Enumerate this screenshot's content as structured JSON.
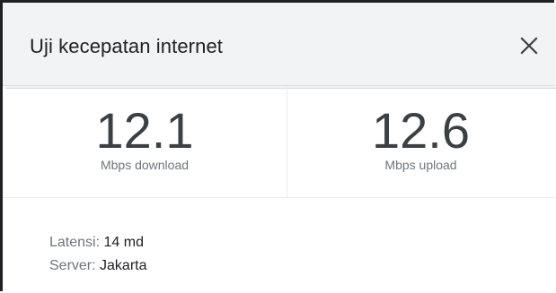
{
  "dialog": {
    "title": "Uji kecepatan internet",
    "close_icon": "close-icon"
  },
  "results": {
    "download": {
      "value": "12.1",
      "unit": "Mbps download"
    },
    "upload": {
      "value": "12.6",
      "unit": "Mbps upload"
    }
  },
  "details": {
    "latency_label": "Latensi:",
    "latency_value": "14 md",
    "server_label": "Server:",
    "server_value": "Jakarta"
  },
  "colors": {
    "header_bg": "#f1f3f4",
    "text_primary": "#202124",
    "text_secondary": "#70757a",
    "value_text": "#3c4043"
  }
}
